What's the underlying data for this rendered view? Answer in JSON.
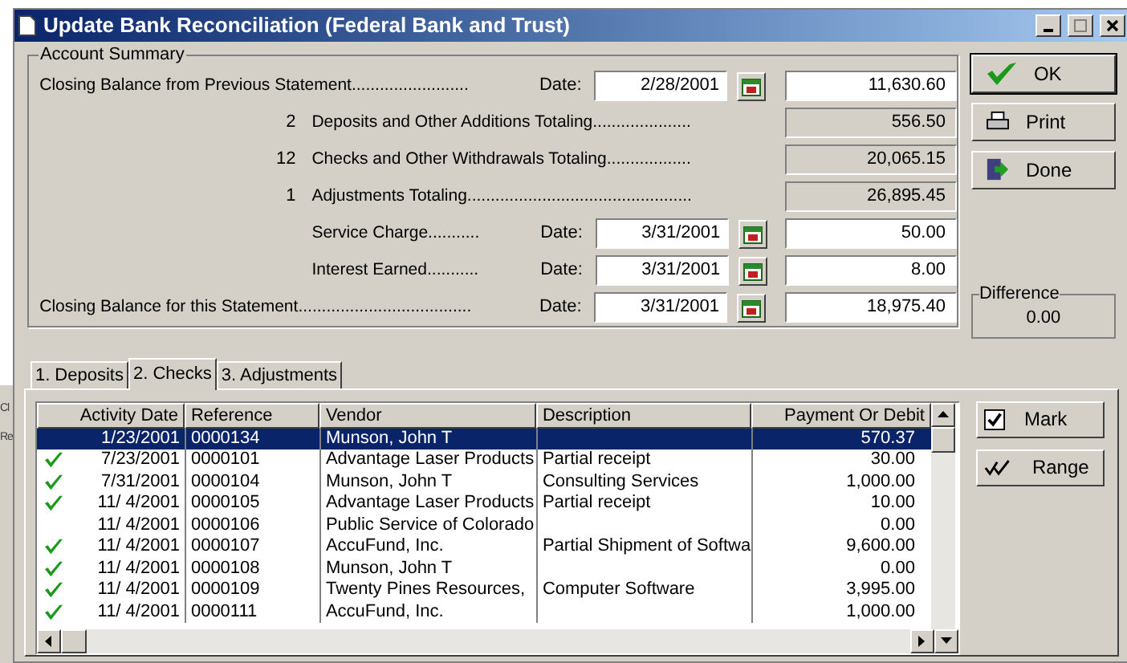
{
  "background_window": {
    "buttons": [
      "Cl",
      "Re"
    ]
  },
  "window": {
    "title": "Update Bank Reconciliation (Federal Bank and Trust)"
  },
  "account_summary": {
    "title": "Account Summary",
    "rows": [
      {
        "kind": "dated",
        "count": "",
        "label": "Closing Balance from Previous Statement.........................",
        "date_label": "Date:",
        "date": "2/28/2001",
        "amount": "11,630.60"
      },
      {
        "kind": "total",
        "count": "2",
        "label": "Deposits and Other Additions Totaling.....................",
        "amount": "556.50"
      },
      {
        "kind": "total",
        "count": "12",
        "label": "Checks and Other Withdrawals Totaling..................",
        "amount": "20,065.15"
      },
      {
        "kind": "total",
        "count": "1",
        "label": "Adjustments Totaling................................................",
        "amount": "26,895.45"
      },
      {
        "kind": "dated_indent",
        "count": "",
        "label": "Service Charge...........",
        "date_label": "Date:",
        "date": "3/31/2001",
        "amount": "50.00"
      },
      {
        "kind": "dated_indent",
        "count": "",
        "label": "Interest Earned...........",
        "date_label": "Date:",
        "date": "3/31/2001",
        "amount": "8.00"
      },
      {
        "kind": "dated",
        "count": "",
        "label": "Closing Balance for this Statement.....................................",
        "date_label": "Date:",
        "date": "3/31/2001",
        "amount": "18,975.40"
      }
    ]
  },
  "buttons": [
    {
      "kind": "ok",
      "label": "OK"
    },
    {
      "kind": "print",
      "label": "Print"
    },
    {
      "kind": "done",
      "label": "Done"
    }
  ],
  "difference": {
    "title": "Difference",
    "value": "0.00"
  },
  "tabs": [
    {
      "label": "1. Deposits",
      "selected": false
    },
    {
      "label": "2. Checks",
      "selected": true
    },
    {
      "label": "3. Adjustments",
      "selected": false
    }
  ],
  "table": {
    "columns": [
      "Activity Date",
      "Reference",
      "Vendor",
      "Description",
      "Payment Or Debit"
    ],
    "rows": [
      {
        "checked": false,
        "selected": true,
        "cells": [
          "1/23/2001",
          "0000134",
          "Munson, John T",
          "",
          "570.37"
        ]
      },
      {
        "checked": true,
        "selected": false,
        "cells": [
          "7/23/2001",
          "0000101",
          "Advantage Laser Products",
          "Partial receipt",
          "30.00"
        ]
      },
      {
        "checked": true,
        "selected": false,
        "cells": [
          "7/31/2001",
          "0000104",
          "Munson, John T",
          "Consulting Services",
          "1,000.00"
        ]
      },
      {
        "checked": true,
        "selected": false,
        "cells": [
          "11/ 4/2001",
          "0000105",
          "Advantage Laser Products",
          "Partial receipt",
          "10.00"
        ]
      },
      {
        "checked": false,
        "selected": false,
        "cells": [
          "11/ 4/2001",
          "0000106",
          "Public Service of Colorado",
          "",
          "0.00"
        ]
      },
      {
        "checked": true,
        "selected": false,
        "cells": [
          "11/ 4/2001",
          "0000107",
          "AccuFund, Inc.",
          "Partial Shipment of Softwa",
          "9,600.00"
        ]
      },
      {
        "checked": true,
        "selected": false,
        "cells": [
          "11/ 4/2001",
          "0000108",
          "Munson, John T",
          "",
          "0.00"
        ]
      },
      {
        "checked": true,
        "selected": false,
        "cells": [
          "11/ 4/2001",
          "0000109",
          "Twenty Pines Resources,",
          "Computer Software",
          "3,995.00"
        ]
      },
      {
        "checked": true,
        "selected": false,
        "cells": [
          "11/ 4/2001",
          "0000111",
          "AccuFund, Inc.",
          "",
          "1,000.00"
        ]
      }
    ]
  },
  "side_buttons": [
    {
      "kind": "mark",
      "label": "Mark"
    },
    {
      "kind": "range",
      "label": "Range"
    }
  ]
}
